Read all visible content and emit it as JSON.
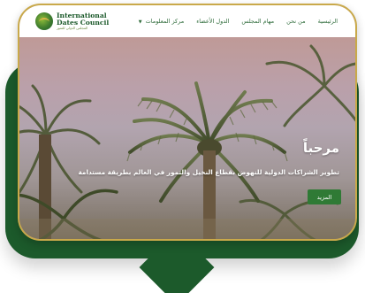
{
  "logo": {
    "line1": "International",
    "line2": "Dates Council",
    "line3": "المجلس الدولي للتمور"
  },
  "nav": {
    "items": [
      {
        "label": "الرئيسية"
      },
      {
        "label": "من نحن"
      },
      {
        "label": "مهام المجلس"
      },
      {
        "label": "الدول الأعضاء"
      },
      {
        "label": "مركز المعلومات",
        "has_dropdown": true
      }
    ]
  },
  "hero": {
    "title": "مرحباً",
    "subtitle": "تطوير الشراكات الدولية للنهوض بقطاع النخيل والتمور في العالم بطريقة مستدامة",
    "button_label": "المزيد"
  },
  "colors": {
    "brand_green": "#1c5a2b",
    "accent_gold": "#c9a94a",
    "button_green": "#2f7a35"
  }
}
